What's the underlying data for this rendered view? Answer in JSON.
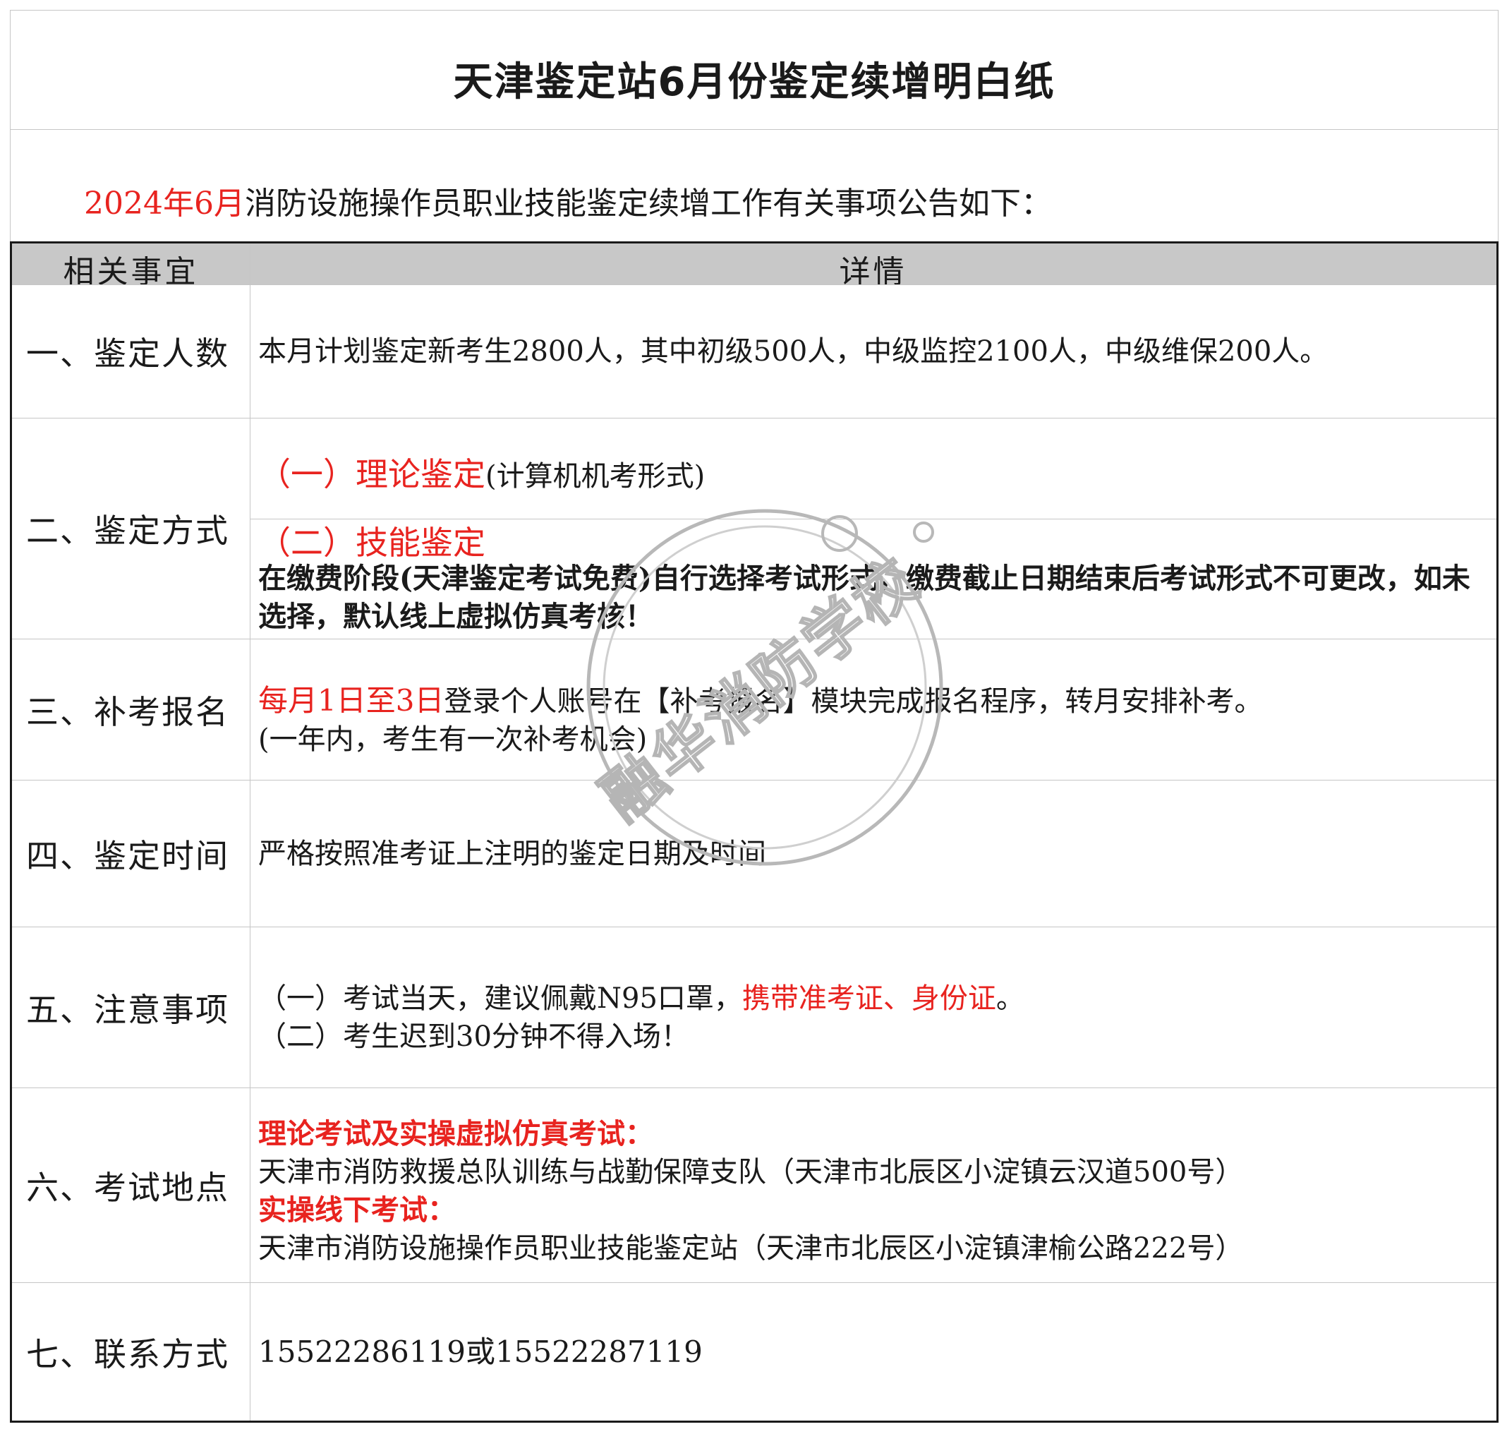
{
  "title": "天津鉴定站6月份鉴定续增明白纸",
  "intro": {
    "red": "2024年6月",
    "rest": "消防设施操作员职业技能鉴定续增工作有关事项公告如下："
  },
  "header": {
    "col1": "相关事宜",
    "col2": "详情"
  },
  "rows": {
    "count": {
      "label": "一、鉴定人数",
      "text": "本月计划鉴定新考生2800人，其中初级500人，中级监控2100人，中级维保200人。"
    },
    "method": {
      "label": "二、鉴定方式",
      "theory_title": "（一）理论鉴定",
      "theory_note": "(计算机机考形式)",
      "skill_title": "（二）技能鉴定",
      "skill_text": "在缴费阶段(天津鉴定考试免费)自行选择考试形式，缴费截止日期结束后考试形式不可更改，如未选择，默认线上虚拟仿真考核！"
    },
    "makeup": {
      "label": "三、补考报名",
      "red": "每月1日至3日",
      "text": "登录个人账号在【补考报名】模块完成报名程序，转月安排补考。",
      "note": "(一年内，考生有一次补考机会)"
    },
    "time": {
      "label": "四、鉴定时间",
      "text": "严格按照准考证上注明的鉴定日期及时间"
    },
    "notice": {
      "label": "五、注意事项",
      "line1_pre": "（一）考试当天，建议佩戴N95口罩，",
      "line1_red": "携带准考证、身份证",
      "line1_post": "。",
      "line2": "（二）考生迟到30分钟不得入场！"
    },
    "location": {
      "label": "六、考试地点",
      "theory_title": "理论考试及实操虚拟仿真考试：",
      "theory_place": "天津市消防救援总队训练与战勤保障支队（天津市北辰区小淀镇云汉道500号）",
      "offline_title": "实操线下考试：",
      "offline_place": "天津市消防设施操作员职业技能鉴定站（天津市北辰区小淀镇津榆公路222号）"
    },
    "contact": {
      "label": "七、联系方式",
      "text": "15522286119或15522287119"
    }
  },
  "watermark": "融华消防学校",
  "colors": {
    "red": "#e8231f",
    "header_bg": "#c8c8c8",
    "border": "#1a1a1a",
    "grid": "#c6c6c6"
  }
}
